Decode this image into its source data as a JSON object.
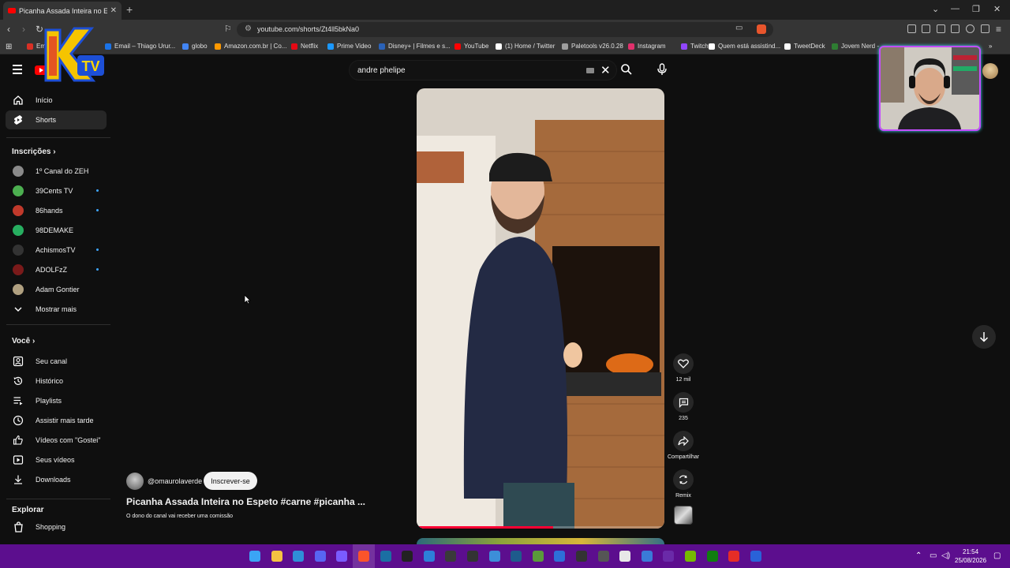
{
  "browser": {
    "tab_title": "Picanha Assada Inteira no Espeto #carne #picanha",
    "new_tab": "+",
    "url": "youtube.com/shorts/Zt4ll5bkNa0",
    "bookmarks": [
      {
        "label": "Em",
        "color": "#d93025"
      },
      {
        "label": "Email – Thiago Urur...",
        "color": "#1a73e8"
      },
      {
        "label": "globo",
        "color": "#4285f4"
      },
      {
        "label": "Amazon.com.br | Co...",
        "color": "#ff9900"
      },
      {
        "label": "Netflix",
        "color": "#e50914"
      },
      {
        "label": "Prime Video",
        "color": "#1a98ff"
      },
      {
        "label": "Disney+ | Filmes e s...",
        "color": "#2a62b8"
      },
      {
        "label": "YouTube",
        "color": "#ff0000"
      },
      {
        "label": "(1) Home / Twitter",
        "color": "#ffffff"
      },
      {
        "label": "Paletools v26.0.28",
        "color": "#9e9e9e"
      },
      {
        "label": "Instagram",
        "color": "#e1306c"
      },
      {
        "label": "Twitch",
        "color": "#9146ff"
      },
      {
        "label": "Quem está assistind...",
        "color": "#ffffff"
      },
      {
        "label": "TweetDeck",
        "color": "#ffffff"
      },
      {
        "label": "Jovem Nerd -",
        "color": "#2e7d32"
      }
    ]
  },
  "youtube": {
    "search_query": "andre phelipe",
    "sidebar": {
      "main": [
        {
          "label": "Início",
          "icon": "home-icon"
        },
        {
          "label": "Shorts",
          "icon": "shorts-icon",
          "active": true
        }
      ],
      "subscriptions_heading": "Inscrições",
      "subscriptions": [
        {
          "label": "1º Canal do ZEH",
          "color": "#8a8a8a",
          "dot": false
        },
        {
          "label": "39Cents TV",
          "color": "#4caf50",
          "dot": true
        },
        {
          "label": "86hands",
          "color": "#c0392b",
          "dot": true
        },
        {
          "label": "98DEMAKE",
          "color": "#27ae60",
          "dot": false
        },
        {
          "label": "AchismosTV",
          "color": "#333333",
          "dot": true
        },
        {
          "label": "ADOLFzZ",
          "color": "#7a1a1a",
          "dot": true
        },
        {
          "label": "Adam Gontier",
          "color": "#b0a080",
          "dot": false
        }
      ],
      "show_more": "Mostrar mais",
      "you_heading": "Você",
      "you": [
        {
          "label": "Seu canal",
          "icon": "channel-icon"
        },
        {
          "label": "Histórico",
          "icon": "history-icon"
        },
        {
          "label": "Playlists",
          "icon": "playlist-icon"
        },
        {
          "label": "Assistir mais tarde",
          "icon": "clock-icon"
        },
        {
          "label": "Vídeos com \"Gostei\"",
          "icon": "thumbs-up-icon"
        },
        {
          "label": "Seus vídeos",
          "icon": "play-icon"
        },
        {
          "label": "Downloads",
          "icon": "download-icon"
        }
      ],
      "explore_heading": "Explorar",
      "explore": [
        {
          "label": "Shopping",
          "icon": "shopping-icon"
        }
      ]
    },
    "short": {
      "channel": "@omaurolaverde",
      "subscribe": "Inscrever-se",
      "title": "Picanha Assada Inteira no Espeto #carne #picanha ...",
      "commission_note": "O dono do canal vai receber uma comissão",
      "progress": 0.55,
      "actions": [
        {
          "icon": "heart-icon",
          "label": "12 mil"
        },
        {
          "icon": "comment-icon",
          "label": "235"
        },
        {
          "icon": "share-icon",
          "label": "Compartilhar"
        },
        {
          "icon": "remix-icon",
          "label": "Remix"
        }
      ]
    }
  },
  "taskbar": {
    "time": "21:54",
    "date": "25/08/2026"
  }
}
